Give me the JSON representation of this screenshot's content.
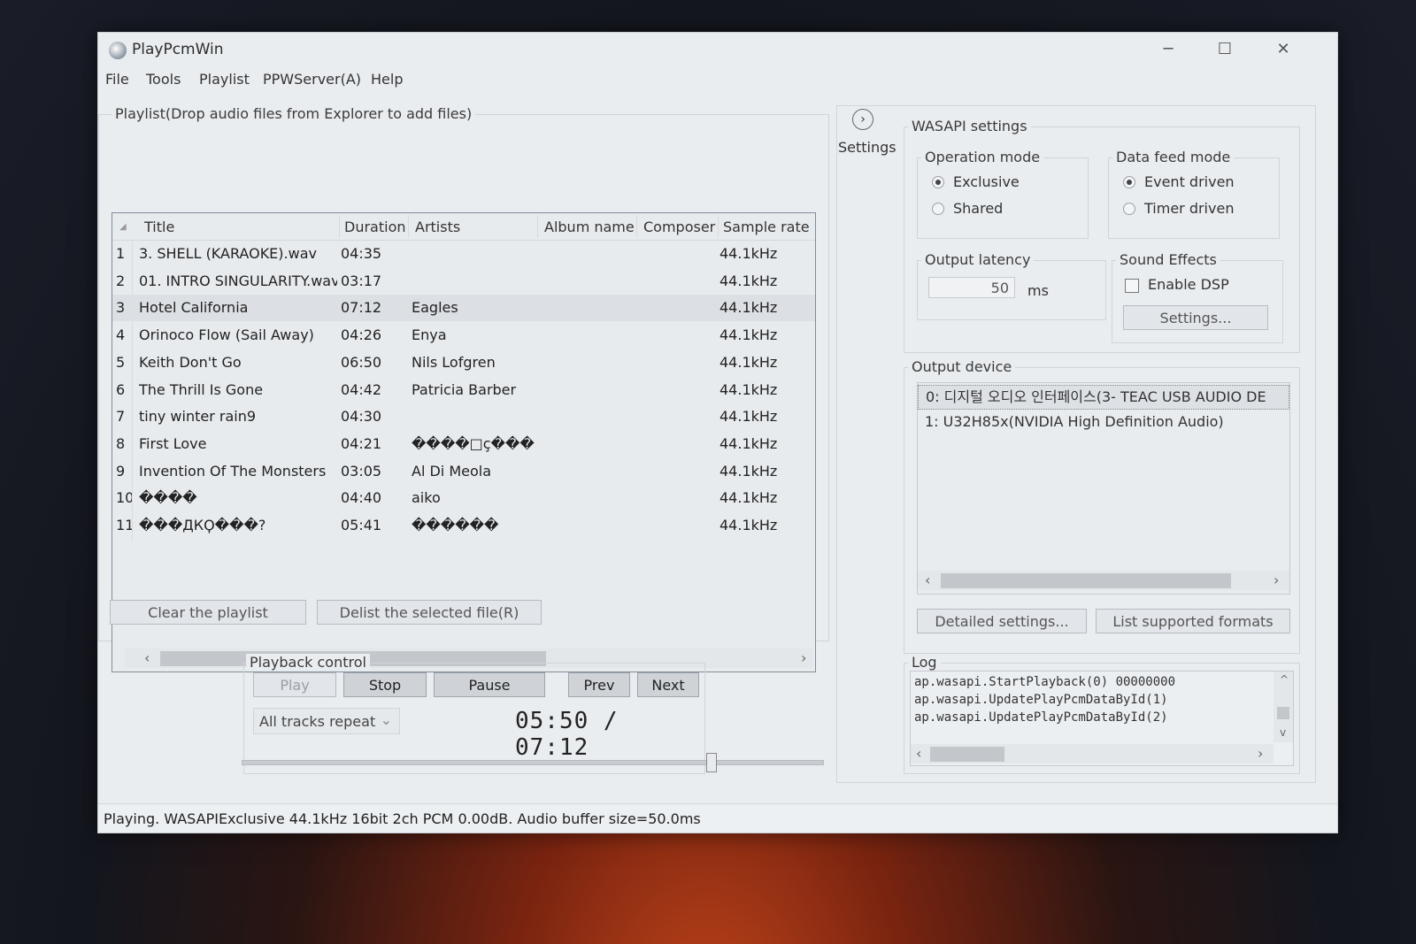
{
  "window": {
    "title": "PlayPcmWin",
    "controls": {
      "minimize": "─",
      "maximize": "☐",
      "close": "✕"
    }
  },
  "menu": [
    "File",
    "Tools",
    "Playlist",
    "PPWServer(A)",
    "Help"
  ],
  "playlist": {
    "group_label": "Playlist(Drop audio files from Explorer to add files)",
    "columns": [
      "Title",
      "Duration",
      "Artists",
      "Album name",
      "Composer",
      "Sample rate"
    ],
    "rows": [
      {
        "n": "1",
        "title": "3. SHELL (KARAOKE).wav",
        "duration": "04:35",
        "artists": "",
        "rate": "44.1kHz"
      },
      {
        "n": "2",
        "title": "01. INTRO SINGULARITY.wav",
        "duration": "03:17",
        "artists": "",
        "rate": "44.1kHz"
      },
      {
        "n": "3",
        "title": "Hotel California",
        "duration": "07:12",
        "artists": "Eagles",
        "rate": "44.1kHz"
      },
      {
        "n": "4",
        "title": "Orinoco Flow (Sail Away)",
        "duration": "04:26",
        "artists": "Enya",
        "rate": "44.1kHz"
      },
      {
        "n": "5",
        "title": "Keith Don't Go",
        "duration": "06:50",
        "artists": "Nils Lofgren",
        "rate": "44.1kHz"
      },
      {
        "n": "6",
        "title": "The Thrill Is Gone",
        "duration": "04:42",
        "artists": "Patricia Barber",
        "rate": "44.1kHz"
      },
      {
        "n": "7",
        "title": "tiny winter rain9",
        "duration": "04:30",
        "artists": "",
        "rate": "44.1kHz"
      },
      {
        "n": "8",
        "title": "First Love",
        "duration": "04:21",
        "artists": "����□ç���",
        "rate": "44.1kHz"
      },
      {
        "n": "9",
        "title": "Invention Of The Monsters",
        "duration": "03:05",
        "artists": "Al Di Meola",
        "rate": "44.1kHz"
      },
      {
        "n": "10",
        "title": "����",
        "duration": "04:40",
        "artists": "aiko",
        "rate": "44.1kHz"
      },
      {
        "n": "11",
        "title": "���ДКϘ���?",
        "duration": "05:41",
        "artists": "������",
        "rate": "44.1kHz"
      }
    ],
    "selected_index": 3,
    "scroll_left": "‹",
    "scroll_right": "›",
    "clear_button": "Clear the playlist",
    "delist_button": "Delist the selected file(R)"
  },
  "playback": {
    "group_label": "Playback control",
    "play": "Play",
    "stop": "Stop",
    "pause": "Pause",
    "prev": "Prev",
    "next": "Next",
    "repeat_mode": "All tracks repeat",
    "combo_arrow": "⌄",
    "time": "05:50 / 07:12",
    "position_fraction": 0.81
  },
  "settings_panel": {
    "toggle_icon": "›",
    "toggle_label": "Settings",
    "wasapi_label": "WASAPI settings",
    "operation_mode": {
      "label": "Operation mode",
      "exclusive": "Exclusive",
      "shared": "Shared",
      "selected": "Exclusive"
    },
    "data_feed_mode": {
      "label": "Data feed mode",
      "event": "Event driven",
      "timer": "Timer driven",
      "selected": "Event driven"
    },
    "output_latency": {
      "label": "Output latency",
      "value": "50",
      "unit": "ms"
    },
    "sound_effects": {
      "label": "Sound Effects",
      "enable_dsp": "Enable DSP",
      "enable_dsp_checked": false,
      "settings_button": "Settings..."
    },
    "output_device": {
      "label": "Output device",
      "devices": [
        "0: 디지털 오디오 인터페이스(3- TEAC USB AUDIO DE",
        "1: U32H85x(NVIDIA High Definition Audio)"
      ],
      "selected_index": 0,
      "scroll_left": "‹",
      "scroll_right": "›",
      "detailed_button": "Detailed settings...",
      "formats_button": "List supported formats"
    },
    "log": {
      "label": "Log",
      "lines": [
        "ap.wasapi.StartPlayback(0) 00000000",
        "ap.wasapi.UpdatePlayPcmDataById(1)",
        "ap.wasapi.UpdatePlayPcmDataById(2)"
      ],
      "scroll_up": "^",
      "scroll_down": "v",
      "scroll_left": "‹",
      "scroll_right": "›"
    }
  },
  "status_bar": "Playing. WASAPIExclusive 44.1kHz 16bit 2ch PCM 0.00dB. Audio buffer size=50.0ms"
}
